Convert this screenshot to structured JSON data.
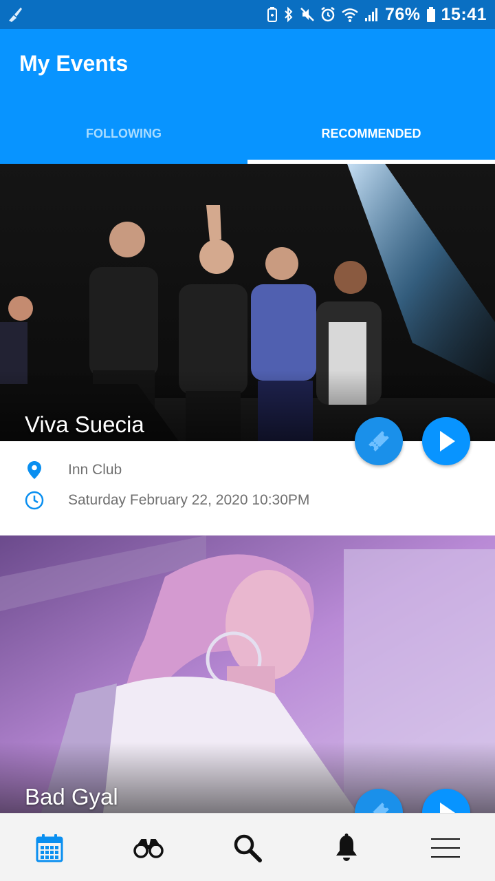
{
  "status_bar": {
    "battery": "76%",
    "time": "15:41",
    "icons": [
      "cleaner-icon",
      "battery-saver-icon",
      "bluetooth-icon",
      "mute-icon",
      "alarm-icon",
      "wifi-icon",
      "signal-icon",
      "battery-icon"
    ]
  },
  "app_bar": {
    "title": "My Events",
    "tabs": [
      {
        "label": "FOLLOWING",
        "selected": false
      },
      {
        "label": "RECOMMENDED",
        "selected": true
      }
    ]
  },
  "events": [
    {
      "name": "Viva Suecia",
      "venue": "Inn Club",
      "datetime": "Saturday February 22, 2020 10:30PM"
    },
    {
      "name": "Bad Gyal"
    }
  ],
  "bottom_nav": {
    "items": [
      {
        "icon": "calendar-icon",
        "active": true
      },
      {
        "icon": "binoculars-icon",
        "active": false
      },
      {
        "icon": "search-icon",
        "active": false
      },
      {
        "icon": "bell-icon",
        "active": false
      },
      {
        "icon": "menu-icon",
        "active": false
      }
    ]
  },
  "colors": {
    "accent": "#0894ff",
    "status_bar": "#0a6fc2",
    "tab_inactive": "#a9dcff",
    "info_text": "#707070"
  }
}
